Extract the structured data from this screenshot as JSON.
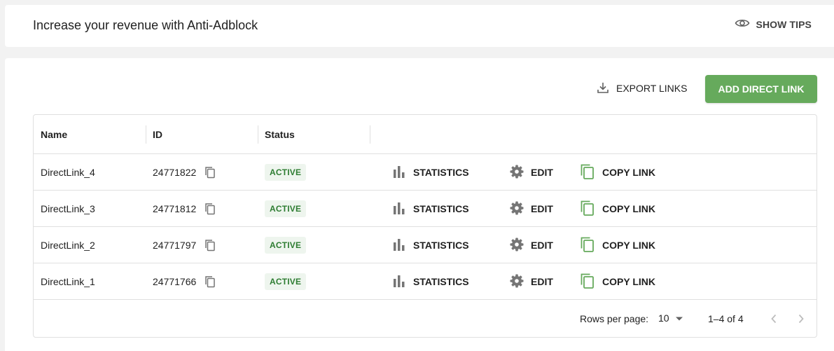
{
  "banner": {
    "title": "Increase your revenue with Anti-Adblock",
    "show_tips_label": "SHOW TIPS",
    "show_tips_icon": "eye-icon"
  },
  "toolbar": {
    "export_label": "EXPORT LINKS",
    "export_icon": "download-icon",
    "add_label": "ADD DIRECT LINK",
    "add_color": "#66aa5c"
  },
  "table": {
    "columns": [
      "Name",
      "ID",
      "Status"
    ],
    "rows": [
      {
        "name": "DirectLink_4",
        "id": "24771822",
        "status": "ACTIVE",
        "statistics": "STATISTICS",
        "edit": "EDIT",
        "copy_link": "COPY LINK"
      },
      {
        "name": "DirectLink_3",
        "id": "24771812",
        "status": "ACTIVE",
        "statistics": "STATISTICS",
        "edit": "EDIT",
        "copy_link": "COPY LINK"
      },
      {
        "name": "DirectLink_2",
        "id": "24771797",
        "status": "ACTIVE",
        "statistics": "STATISTICS",
        "edit": "EDIT",
        "copy_link": "COPY LINK"
      },
      {
        "name": "DirectLink_1",
        "id": "24771766",
        "status": "ACTIVE",
        "statistics": "STATISTICS",
        "edit": "EDIT",
        "copy_link": "COPY LINK"
      }
    ],
    "status_color": "#2e7d32",
    "copy_link_icon_color": "#66aa5c"
  },
  "pagination": {
    "rows_per_page_label": "Rows per page:",
    "rows_per_page_value": "10",
    "range_label": "1–4 of 4"
  }
}
